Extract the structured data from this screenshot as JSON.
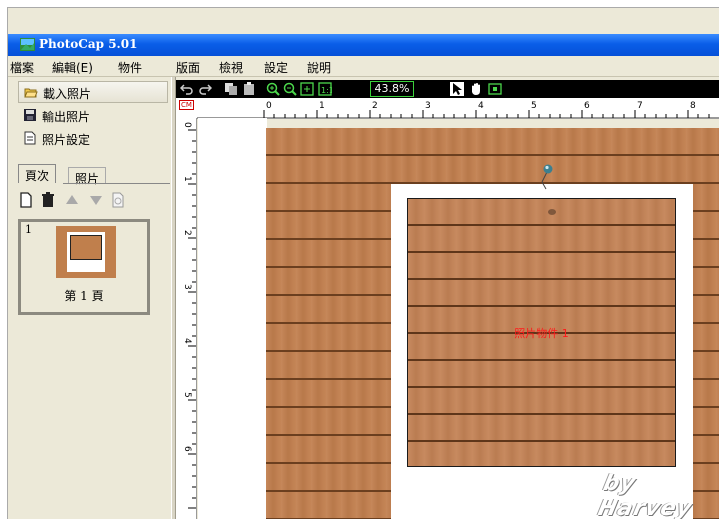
{
  "window": {
    "title": "PhotoCap 5.01"
  },
  "menu": [
    "檔案",
    "編輯(E)",
    "物件",
    "版面",
    "檢視",
    "設定",
    "說明"
  ],
  "left_panel": {
    "load_photo": "載入照片",
    "export_photo": "輸出照片",
    "photo_settings": "照片設定",
    "tabs": [
      "頁次",
      "照片"
    ],
    "pages": [
      {
        "number": "1",
        "label": "第 1 頁"
      }
    ]
  },
  "toolbar": {
    "zoom_value": "43.8%"
  },
  "ruler": {
    "unit": "CM",
    "h_labels": [
      "0",
      "1",
      "2",
      "3",
      "4",
      "5",
      "6",
      "7",
      "8"
    ],
    "v_labels": [
      "0",
      "1",
      "2",
      "3",
      "4",
      "5",
      "6"
    ]
  },
  "canvas": {
    "photo_object_label": "照片物件 1",
    "watermark": "by Harvey"
  },
  "colors": {
    "title_bar": "#0a5ee8",
    "wood": "#c27f4e",
    "photo_label": "#ff1a1a"
  }
}
